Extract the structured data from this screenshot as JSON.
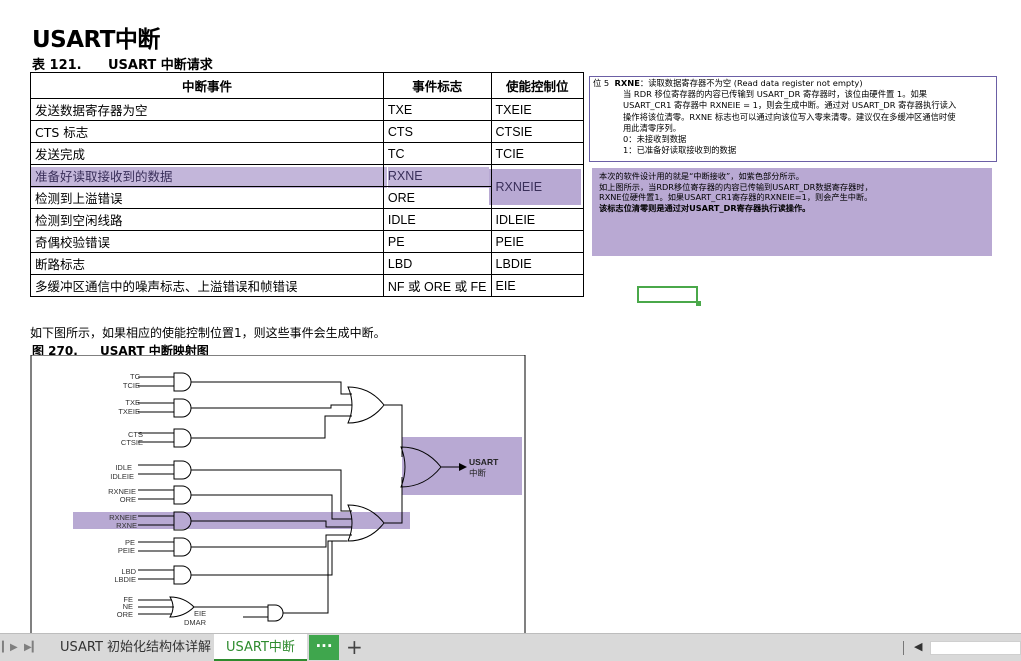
{
  "title": "USART中断",
  "table": {
    "caption_num": "表 121.",
    "caption_title": "USART 中断请求",
    "headers": [
      "中断事件",
      "事件标志",
      "使能控制位"
    ],
    "rows": [
      {
        "event": "发送数据寄存器为空",
        "flag": "TXE",
        "enable": "TXEIE"
      },
      {
        "event": "CTS 标志",
        "flag": "CTS",
        "enable": "CTSIE"
      },
      {
        "event": "发送完成",
        "flag": "TC",
        "enable": "TCIE"
      },
      {
        "event": "准备好读取接收到的数据",
        "flag": "RXNE",
        "enable": "RXNEIE"
      },
      {
        "event": "检测到上溢错误",
        "flag": "ORE",
        "enable": ""
      },
      {
        "event": "检测到空闲线路",
        "flag": "IDLE",
        "enable": "IDLEIE"
      },
      {
        "event": "奇偶校验错误",
        "flag": "PE",
        "enable": "PEIE"
      },
      {
        "event": "断路标志",
        "flag": "LBD",
        "enable": "LBDIE"
      },
      {
        "event": "多缓冲区通信中的噪声标志、上溢错误和帧错误",
        "flag": "NF 或 ORE 或 FE",
        "enable": "EIE"
      }
    ]
  },
  "register_desc": {
    "bit": "位 5",
    "name": "RXNE",
    "summary": "：读取数据寄存器不为空 (Read data register not empty)",
    "line1": "当 RDR 移位寄存器的内容已传输到 USART_DR 寄存器时，该位由硬件置 1。如果",
    "line2": "USART_CR1 寄存器中 RXNEIE = 1，则会生成中断。通过对 USART_DR 寄存器执行读入",
    "line3": "操作将该位清零。RXNE 标志也可以通过向该位写入零来清零。建议仅在多缓冲区通信时使",
    "line4": "用此清零序列。",
    "val0": "0：未接收到数据",
    "val1": "1：已准备好读取接收到的数据"
  },
  "note": {
    "line1": "本次的软件设计用的就是“中断接收”，如紫色部分所示。",
    "line2": "如上图所示，当RDR移位寄存器的内容已传输到USART_DR数据寄存器时，",
    "line3": "RXNE位硬件置1。如果USART_CR1寄存器的RXNEIE=1，则会产生中断。",
    "line4": "该标志位清零则是通过对USART_DR寄存器执行读操作。"
  },
  "paragraph": "如下图所示，如果相应的使能控制位置1，则这些事件会生成中断。",
  "figure": {
    "caption_num": "图 270.",
    "caption_title": "USART 中断映射图",
    "output_label_1": "USART",
    "output_label_2": "中断",
    "inputs": {
      "tc": "TC",
      "tcie": "TCIE",
      "txe": "TXE",
      "txeie": "TXEIE",
      "cts": "CTS",
      "ctsie": "CTSIE",
      "idle": "IDLE",
      "idleie": "IDLEIE",
      "rxneie_a": "RXNEIE",
      "ore": "ORE",
      "rxneie_b": "RXNEIE",
      "rxne": "RXNE",
      "pe": "PE",
      "peie": "PEIE",
      "lbd": "LBD",
      "lbdie": "LBDIE",
      "fe": "FE",
      "ne": "NE",
      "ore2": "ORE",
      "eie": "EIE",
      "dmar": "DMAR"
    }
  },
  "tabs": {
    "tab1": "USART 初始化结构体详解",
    "tab2": "USART中断",
    "more": "···",
    "add": "+"
  },
  "colors": {
    "highlight": "#b8a9d3",
    "active_tab": "#2e8b2e",
    "more_button": "#3fa64d",
    "selection": "#4aa84a"
  }
}
